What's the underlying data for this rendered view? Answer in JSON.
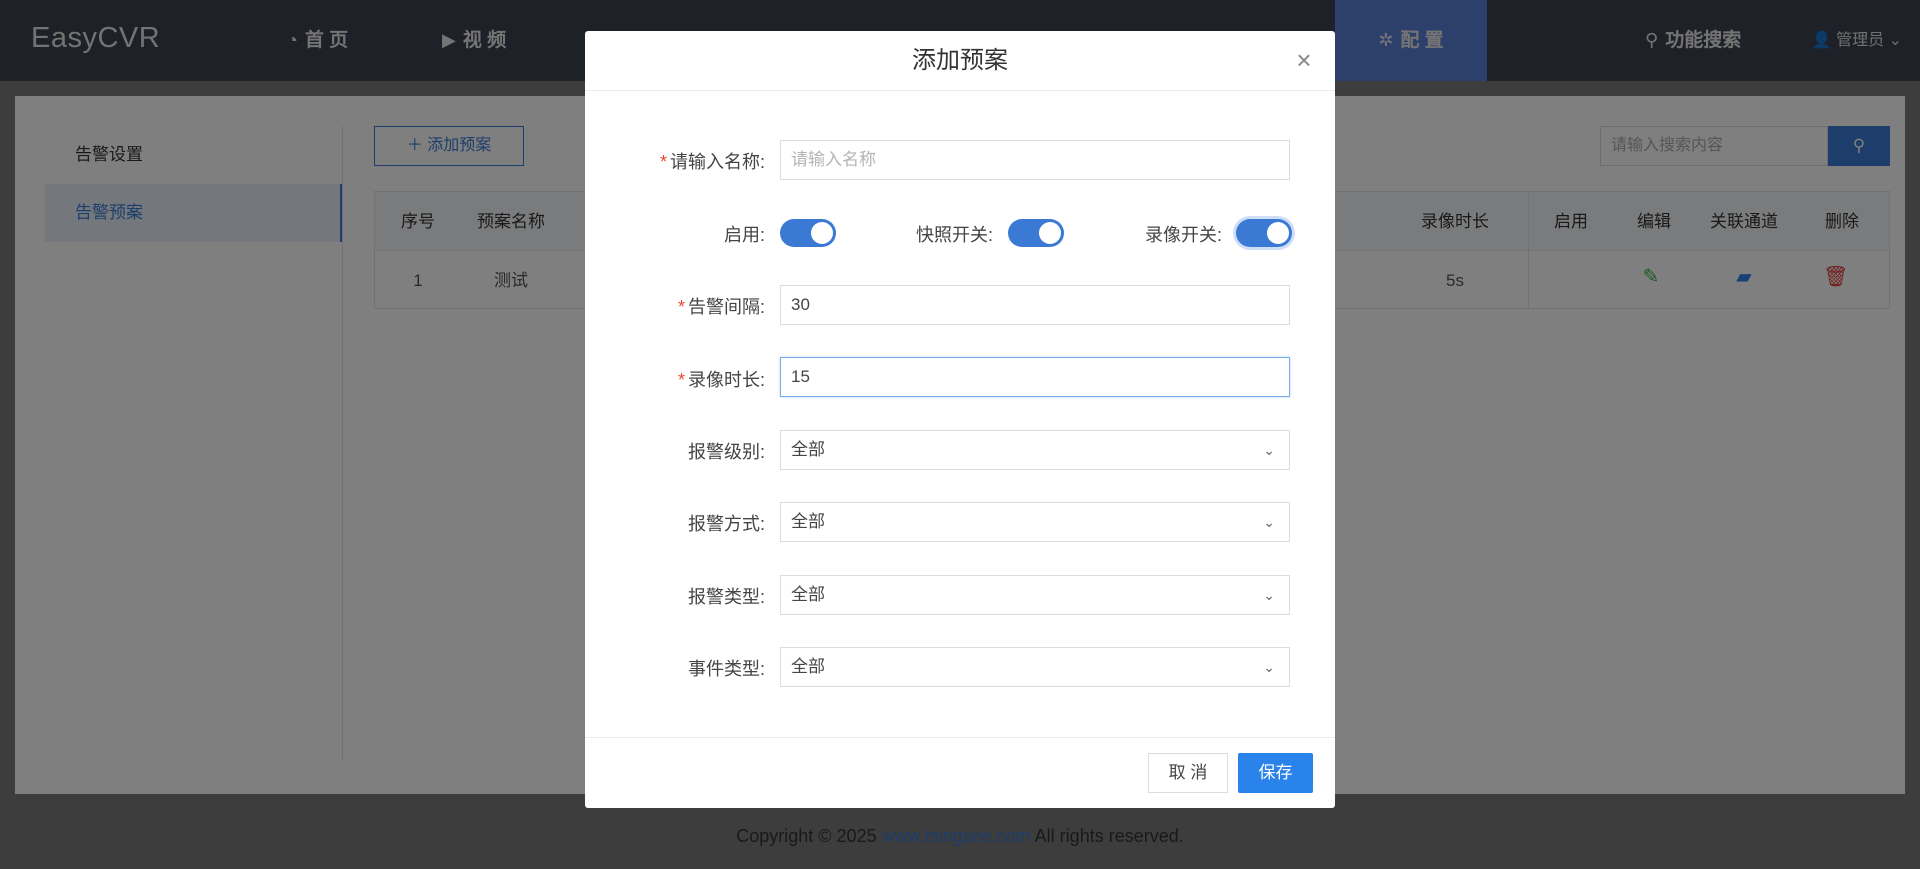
{
  "app": {
    "brand": "EasyCVR"
  },
  "nav": {
    "items": [
      {
        "icon": "dashboard-icon",
        "label": "首 页"
      },
      {
        "icon": "play-icon",
        "label": "视 频"
      },
      {
        "icon": "gear-icon",
        "label": "配 置"
      }
    ],
    "search_label": "功能搜索",
    "user_label": "管理员"
  },
  "sidebar": {
    "items": [
      {
        "label": "告警设置"
      },
      {
        "label": "告警预案"
      }
    ]
  },
  "toolbar": {
    "add_label": "添加预案",
    "search_placeholder": "请输入搜索内容"
  },
  "table": {
    "headers": [
      "序号",
      "预案名称",
      "录像时长",
      "启用",
      "编辑",
      "关联通道",
      "删除"
    ],
    "rows": [
      {
        "index": "1",
        "name": "测试",
        "record_duration": "5s",
        "enabled": true
      }
    ]
  },
  "footer": {
    "prefix": "Copyright © 2025 ",
    "link": "www.tsingsee.com",
    "suffix": " All rights reserved."
  },
  "modal": {
    "title": "添加预案",
    "fields": {
      "name_label": "请输入名称:",
      "name_placeholder": "请输入名称",
      "enable_label": "启用:",
      "snapshot_label": "快照开关:",
      "record_label": "录像开关:",
      "interval_label": "告警间隔:",
      "interval_value": "30",
      "duration_label": "录像时长:",
      "duration_value": "15",
      "level_label": "报警级别:",
      "level_value": "全部",
      "method_label": "报警方式:",
      "method_value": "全部",
      "type_label": "报警类型:",
      "type_value": "全部",
      "event_label": "事件类型:",
      "event_value": "全部"
    },
    "toggles": {
      "enable": true,
      "snapshot": true,
      "record": true
    },
    "cancel_label": "取 消",
    "save_label": "保存"
  },
  "colors": {
    "nav_bg": "#3c4250",
    "accent": "#3a7ad5",
    "save": "#2a83ea",
    "required": "#e8452f"
  }
}
